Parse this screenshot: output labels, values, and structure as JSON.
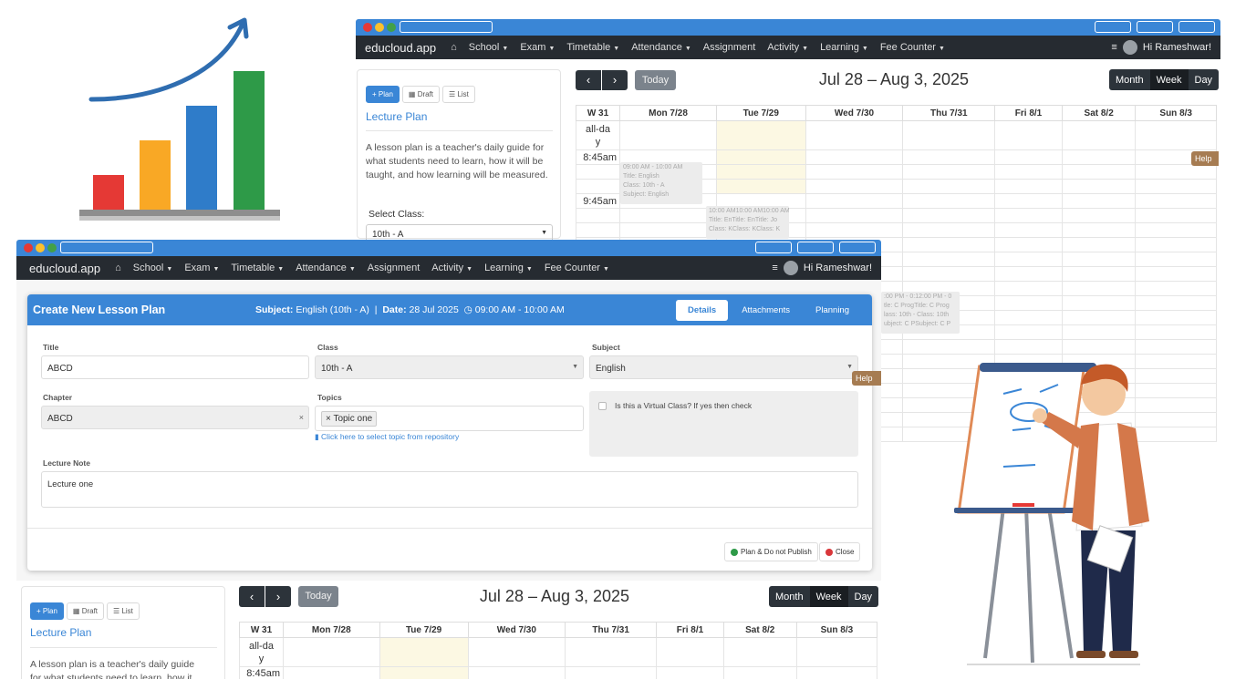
{
  "app": {
    "brand": "educloud.app",
    "greeting": "Hi Rameshwar!"
  },
  "nav": {
    "items": [
      {
        "label": "School",
        "caret": true
      },
      {
        "label": "Exam",
        "caret": true
      },
      {
        "label": "Timetable",
        "caret": true
      },
      {
        "label": "Attendance",
        "caret": true
      },
      {
        "label": "Assignment",
        "caret": false
      },
      {
        "label": "Activity",
        "caret": true
      },
      {
        "label": "Learning",
        "caret": true
      },
      {
        "label": "Fee Counter",
        "caret": true
      }
    ]
  },
  "side_panel": {
    "buttons": {
      "plan": "+ Plan",
      "draft": "Draft",
      "list": "List"
    },
    "title": "Lecture Plan",
    "description": "A lesson plan is a teacher's daily guide for what students need to learn, how it will be taught, and how learning will be measured.",
    "description_line1": "A lesson plan is a teacher's daily guide",
    "description_line2": "for what students need to learn, how it",
    "select_class_label": "Select Class:",
    "select_class_value": "10th - A"
  },
  "calendar": {
    "prev": "‹",
    "next": "›",
    "today": "Today",
    "range": "Jul 28 – Aug 3, 2025",
    "views": [
      "Month",
      "Week",
      "Day"
    ],
    "active_view": "Week",
    "week_label": "W 31",
    "days": [
      "Mon 7/28",
      "Tue 7/29",
      "Wed 7/30",
      "Thu 7/31",
      "Fri 8/1",
      "Sat 8/2",
      "Sun 8/3"
    ],
    "allday_a": "all-da",
    "allday_b": "y",
    "times": [
      "8:45am",
      "9:45am"
    ],
    "highlight_color": "#fcf8e3",
    "events": {
      "mon": [
        "09:00 AM - 10:00 AM",
        "Title: English",
        "Class: 10th - A",
        "Subject: English"
      ],
      "tue": [
        "10:00 AM10:00 AM10:00 AM",
        "Title: EnTitle: EnTitle: Jo",
        "Class: KClass: KClass: K"
      ],
      "thu": [
        ":00 PM - 0:12:00 PM - 0",
        "tle: C ProgTitle: C Prog",
        "lass: 10th - Class: 10th",
        "ubject: C PSubject: C P"
      ]
    },
    "help": "Help"
  },
  "modal": {
    "title": "Create New Lesson Plan",
    "subject_label": "Subject:",
    "subject_value": "English (10th - A)",
    "separator": "|",
    "date_label": "Date:",
    "date_value": "28 Jul 2025",
    "time_value": "09:00 AM - 10:00 AM",
    "tabs": [
      "Details",
      "Attachments",
      "Planning"
    ],
    "active_tab": "Details",
    "fields": {
      "title_label": "Title",
      "title_value": "ABCD",
      "class_label": "Class",
      "class_value": "10th - A",
      "subject_label": "Subject",
      "subject_value": "English",
      "chapter_label": "Chapter",
      "chapter_value": "ABCD",
      "topics_label": "Topics",
      "topic_chip": "Topic one",
      "topic_link": "Click here to select topic from repository",
      "virtual_label": "Is this a Virtual Class? If yes then check",
      "note_label": "Lecture Note",
      "note_value": "Lecture one"
    },
    "buttons": {
      "plan": "Plan & Do not Publish",
      "close": "Close"
    },
    "help": "Help"
  },
  "colors": {
    "accent": "#3a86d6",
    "navbar": "#262b31",
    "help": "#a67c52"
  }
}
